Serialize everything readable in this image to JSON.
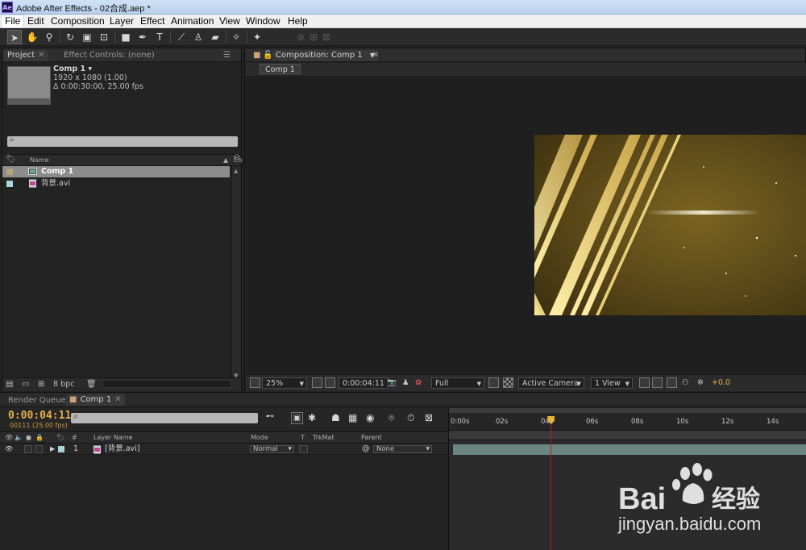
{
  "window": {
    "title": "Adobe After Effects - 02合成.aep *",
    "app_icon": "Ae"
  },
  "menu": [
    "File",
    "Edit",
    "Composition",
    "Layer",
    "Effect",
    "Animation",
    "View",
    "Window",
    "Help"
  ],
  "project_panel": {
    "tabs": [
      "Project",
      "Effect Controls: (none)"
    ],
    "comp_name": "Comp 1 ▾",
    "comp_res": "1920 x 1080 (1.00)",
    "comp_dur": "Δ 0:00:30:00, 25.00 fps",
    "search_placeholder": "⌕",
    "columns": {
      "name": "Name",
      "comment": "Co"
    },
    "items": [
      {
        "name": "Comp 1",
        "swatch": "#b7a27d",
        "type": "comp"
      },
      {
        "name": "背景.avi",
        "swatch": "#a9d6d6",
        "type": "footage"
      }
    ],
    "bpc": "8 bpc"
  },
  "comp_panel": {
    "tab": "Composition: Comp 1",
    "breadcrumb": "Comp 1",
    "zoom": "25%",
    "timecode": "0:00:04:11",
    "resolution": "Full",
    "camera": "Active Camera",
    "views": "1 View",
    "exposure": "+0.0"
  },
  "timeline": {
    "tabs": [
      "Render Queue",
      "Comp 1"
    ],
    "timecode": "0:00:04:11",
    "frames": "00111 (25.00 fps)",
    "search_placeholder": "⌕",
    "columns": {
      "num": "#",
      "layer_name": "Layer Name",
      "mode": "Mode",
      "t": "T",
      "trkmat": "TrkMat",
      "parent": "Parent"
    },
    "layers": [
      {
        "num": "1",
        "name": "[背景.avi]",
        "mode": "Normal",
        "parent": "None",
        "color": "#a9d6d6"
      }
    ],
    "ruler": [
      "0:00s",
      "02s",
      "04s",
      "06s",
      "08s",
      "10s",
      "12s",
      "14s"
    ],
    "playhead_seconds": 4.44
  },
  "watermark": {
    "brand": "Bai",
    "brand_cn": "经验",
    "url": "jingyan.baidu.com"
  }
}
